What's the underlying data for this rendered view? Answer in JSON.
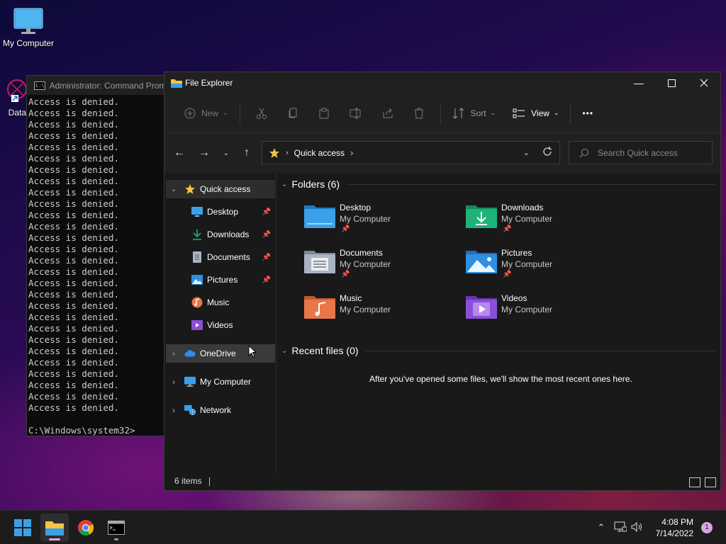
{
  "desktop": {
    "icons": [
      {
        "label": "My Computer"
      },
      {
        "label": "DataW"
      }
    ]
  },
  "cmd": {
    "title": "Administrator: Command Prompt",
    "line": "Access is denied.",
    "line_count": 28,
    "prompt": "C:\\Windows\\system32>"
  },
  "explorer": {
    "title": "File Explorer",
    "toolbar": {
      "new_label": "New",
      "sort_label": "Sort",
      "view_label": "View",
      "more_label": "•••"
    },
    "address": {
      "location": "Quick access"
    },
    "search": {
      "placeholder": "Search Quick access"
    },
    "sidebar": {
      "quick_access": "Quick access",
      "pinned": [
        {
          "label": "Desktop",
          "pinned": true
        },
        {
          "label": "Downloads",
          "pinned": true
        },
        {
          "label": "Documents",
          "pinned": true
        },
        {
          "label": "Pictures",
          "pinned": true
        },
        {
          "label": "Music",
          "pinned": false
        },
        {
          "label": "Videos",
          "pinned": false
        }
      ],
      "onedrive": "OneDrive",
      "my_computer": "My Computer",
      "network": "Network"
    },
    "folders_header": "Folders (6)",
    "folders": [
      {
        "name": "Desktop",
        "location": "My Computer",
        "pinned": true
      },
      {
        "name": "Downloads",
        "location": "My Computer",
        "pinned": true
      },
      {
        "name": "Documents",
        "location": "My Computer",
        "pinned": true
      },
      {
        "name": "Pictures",
        "location": "My Computer",
        "pinned": true
      },
      {
        "name": "Music",
        "location": "My Computer",
        "pinned": false
      },
      {
        "name": "Videos",
        "location": "My Computer",
        "pinned": false
      }
    ],
    "recent_header": "Recent files (0)",
    "recent_empty": "After you've opened some files, we'll show the most recent ones here.",
    "status": "6 items"
  },
  "taskbar": {
    "time": "4:08 PM",
    "date": "7/14/2022",
    "notifications": "1"
  },
  "colors": {
    "accent": "#60cdff",
    "folder_blue": "#3aa0e8",
    "download_green": "#1fb37a",
    "music_orange": "#e8774a",
    "video_purple": "#8a4fd8",
    "quick_star": "#f6c342"
  }
}
